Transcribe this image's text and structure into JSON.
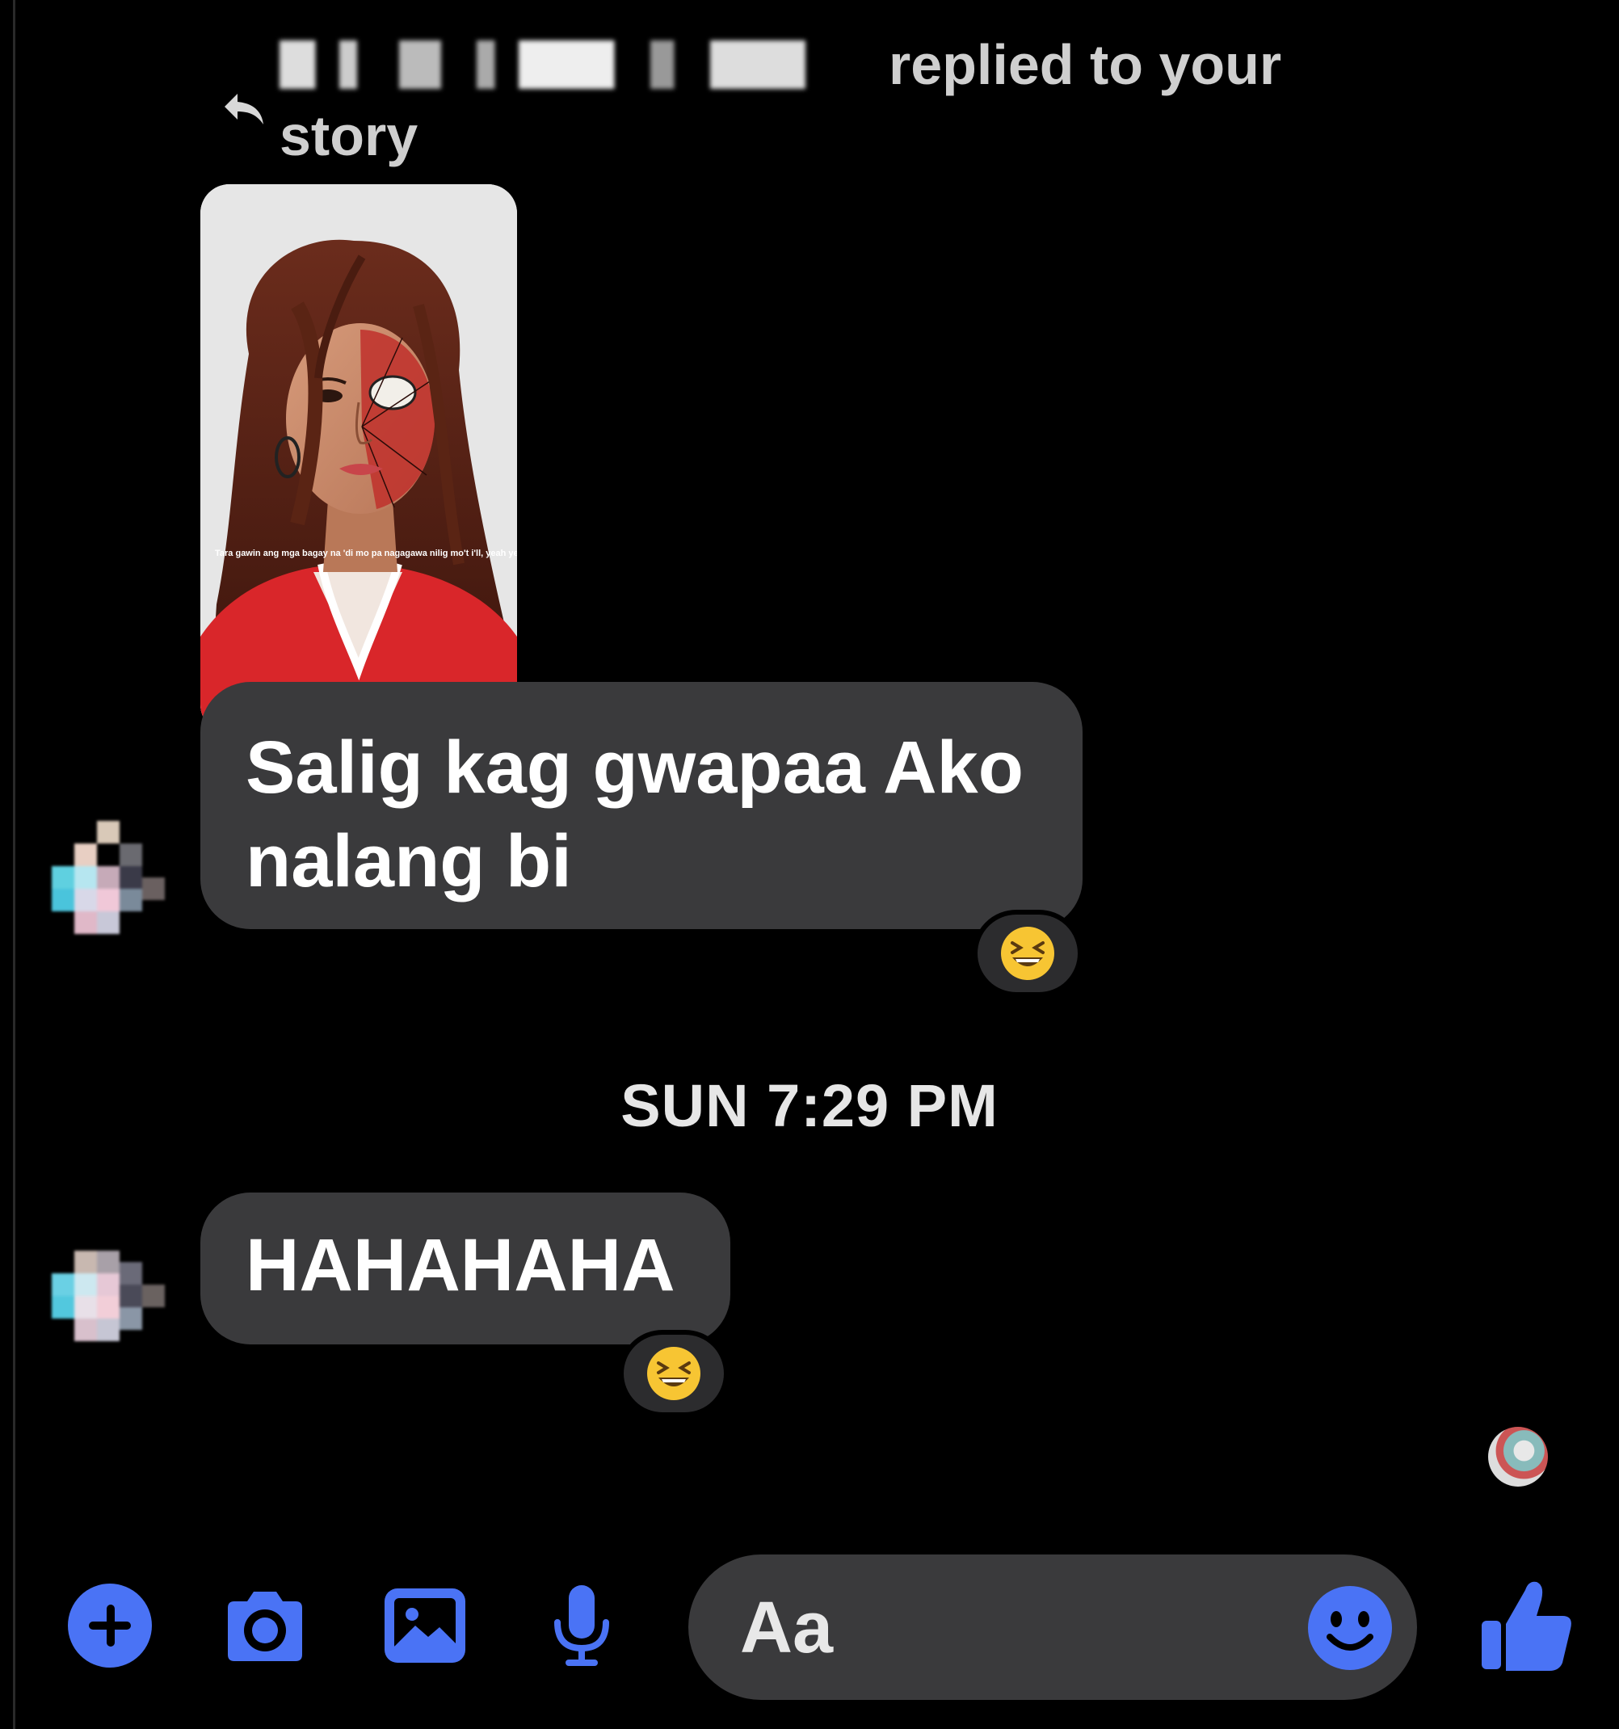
{
  "story_reply": {
    "sender_name": "",
    "header_text": "replied to your story",
    "story_caption": "Tara gawin ang mga bagay na 'di mo pa nagagawa\nnilig mo't i'll, yeah\nyeah, yeah"
  },
  "messages": [
    {
      "text": "Salig kag gwapaa Ako nalang bi",
      "reaction": "laughing-emoji"
    },
    {
      "text": "HAHAHAHA",
      "reaction": "laughing-emoji"
    }
  ],
  "timestamp": "SUN 7:29 PM",
  "composer": {
    "placeholder": "Aa",
    "icons": [
      "plus-icon",
      "camera-icon",
      "gallery-icon",
      "microphone-icon",
      "emoji-icon",
      "thumbs-up-icon"
    ]
  },
  "colors": {
    "background": "#000000",
    "bubble": "#3a3a3c",
    "accent": "#4a73f5"
  }
}
